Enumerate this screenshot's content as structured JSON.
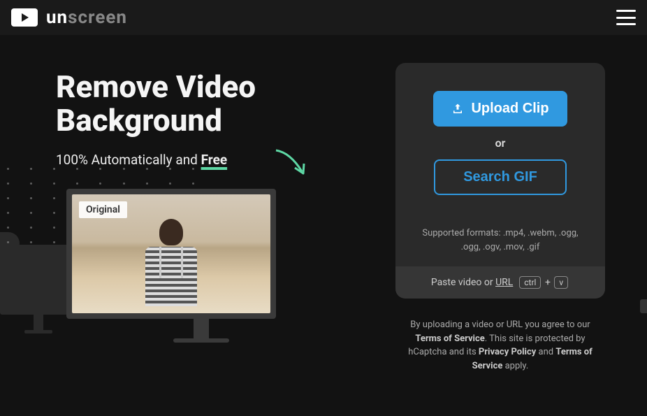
{
  "header": {
    "brand_prefix": "un",
    "brand_suffix": "screen"
  },
  "hero": {
    "heading_line1": "Remove Video",
    "heading_line2": "Background",
    "subtitle_prefix": "100% Automatically and ",
    "subtitle_free": "Free",
    "original_label": "Original"
  },
  "panel": {
    "upload_label": "Upload Clip",
    "or_label": "or",
    "search_label": "Search GIF",
    "formats_text": "Supported formats: .mp4, .webm, .ogg, .ogg, .ogv, .mov, .gif",
    "paste_prefix": "Paste video or ",
    "paste_url_label": "URL",
    "kbd_ctrl": "ctrl",
    "kbd_plus": " + ",
    "kbd_v": "v"
  },
  "legal": {
    "part1": "By uploading a video or URL you agree to our ",
    "tos1": "Terms of Service",
    "part2": ". This site is protected by hCaptcha and its ",
    "privacy": "Privacy Policy",
    "part3": " and ",
    "tos2": "Terms of Service",
    "part4": " apply."
  }
}
